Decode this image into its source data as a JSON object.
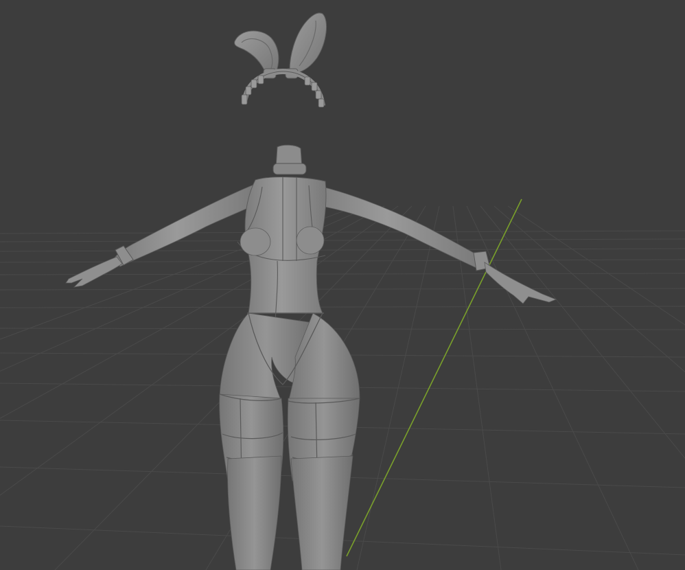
{
  "viewport": {
    "mode": "3d-viewport-solid-shading",
    "background_color": "#3d3d3d",
    "grid_color": "#4a4a4a",
    "y_axis_color": "#7aa02b",
    "model_color": "#8e8e8e",
    "model_shadow_color": "#6f6f6f",
    "objects": [
      "bunny-ears-headband",
      "headless-body-mesh"
    ]
  }
}
